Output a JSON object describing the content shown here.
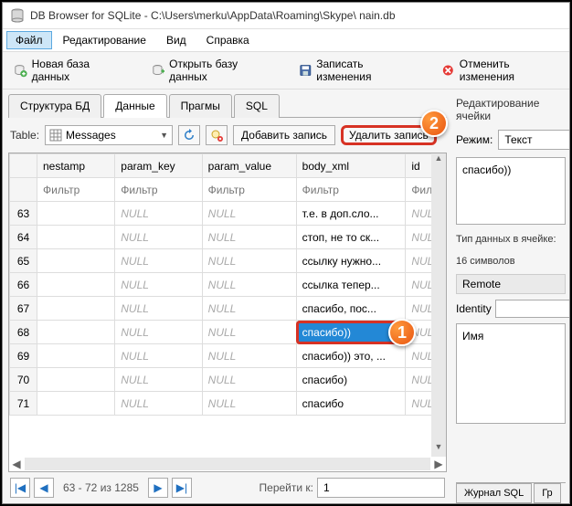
{
  "titlebar": {
    "title": "DB Browser for SQLite - C:\\Users\\merku\\AppData\\Roaming\\Skype\\            nain.db"
  },
  "menubar": {
    "file": "Файл",
    "edit": "Редактирование",
    "view": "Вид",
    "help": "Справка"
  },
  "toolbar": {
    "new_db": "Новая база данных",
    "open_db": "Открыть базу данных",
    "save_changes": "Записать изменения",
    "revert_changes": "Отменить изменения"
  },
  "tabs": {
    "structure": "Структура БД",
    "data": "Данные",
    "pragmas": "Прагмы",
    "sql": "SQL"
  },
  "tablebar": {
    "label": "Table:",
    "combo_value": "Messages",
    "add_record": "Добавить запись",
    "delete_record": "Удалить запись"
  },
  "columns": [
    "nestamp",
    "param_key",
    "param_value",
    "body_xml",
    "identities"
  ],
  "filter_placeholder": "Фильтр",
  "filter_placeholder_short": "Филь",
  "rows": [
    {
      "n": "63",
      "c": [
        "",
        "NULL",
        "NULL",
        "т.е. в доп.сло...",
        "NULL"
      ]
    },
    {
      "n": "64",
      "c": [
        "",
        "NULL",
        "NULL",
        "стоп, не то ск...",
        "NULL"
      ]
    },
    {
      "n": "65",
      "c": [
        "",
        "NULL",
        "NULL",
        "ссылку нужно...",
        "NULL"
      ]
    },
    {
      "n": "66",
      "c": [
        "",
        "NULL",
        "NULL",
        "ссылка тепер...",
        "NULL"
      ]
    },
    {
      "n": "67",
      "c": [
        "",
        "NULL",
        "NULL",
        "спасибо, пос...",
        "NULL"
      ]
    },
    {
      "n": "68",
      "c": [
        "",
        "NULL",
        "NULL",
        "спасибо))",
        "NULL"
      ]
    },
    {
      "n": "69",
      "c": [
        "",
        "NULL",
        "NULL",
        "спасибо)) это, ...",
        "NULL"
      ]
    },
    {
      "n": "70",
      "c": [
        "",
        "NULL",
        "NULL",
        "спасибо)",
        "NULL"
      ]
    },
    {
      "n": "71",
      "c": [
        "",
        "NULL",
        "NULL",
        "спасибо",
        "NULL"
      ]
    }
  ],
  "selected_row_index": 5,
  "pager": {
    "info": "63 - 72 из 1285",
    "jump_label": "Перейти к:",
    "jump_value": "1"
  },
  "right": {
    "edit_cell_label": "Редактирование ячейки",
    "mode_label": "Режим:",
    "mode_value": "Текст",
    "cell_value": "спасибо))",
    "type_label": "Тип данных в ячейке:",
    "size_label": "16 символов",
    "remote_label": "Remote",
    "identity_label": "Identity",
    "identity_value": "",
    "name_label": "Имя",
    "journal_tab": "Журнал SQL",
    "gr_tab": "Гр"
  },
  "badges": {
    "one": "1",
    "two": "2"
  }
}
